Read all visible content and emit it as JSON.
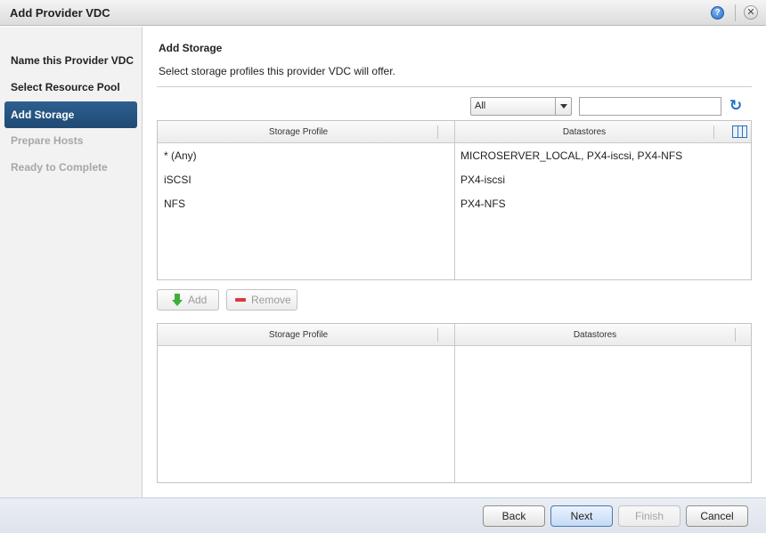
{
  "window": {
    "title": "Add Provider VDC",
    "help_symbol": "?",
    "close_symbol": "✕"
  },
  "sidebar": {
    "steps": [
      {
        "label": "Name this Provider VDC",
        "state": "done"
      },
      {
        "label": "Select Resource Pool",
        "state": "done"
      },
      {
        "label": "Add Storage",
        "state": "active"
      },
      {
        "label": "Prepare Hosts",
        "state": "disabled"
      },
      {
        "label": "Ready to Complete",
        "state": "disabled"
      }
    ]
  },
  "main": {
    "heading": "Add Storage",
    "description": "Select storage profiles this provider VDC will offer.",
    "filter": {
      "selected": "All",
      "search_value": ""
    },
    "available_table": {
      "columns": [
        "Storage Profile",
        "Datastores"
      ],
      "rows": [
        {
          "profile": "* (Any)",
          "datastores": "MICROSERVER_LOCAL, PX4-iscsi, PX4-NFS"
        },
        {
          "profile": "iSCSI",
          "datastores": "PX4-iscsi"
        },
        {
          "profile": "NFS",
          "datastores": "PX4-NFS"
        }
      ]
    },
    "buttons": {
      "add": "Add",
      "remove": "Remove"
    },
    "selected_table": {
      "columns": [
        "Storage Profile",
        "Datastores"
      ],
      "rows": []
    }
  },
  "footer": {
    "back": "Back",
    "next": "Next",
    "finish": "Finish",
    "cancel": "Cancel"
  },
  "colors": {
    "active_step": "#244f7a",
    "accent_blue": "#1a73c9",
    "add_icon": "#3fae3a",
    "remove_icon": "#d9393f"
  }
}
